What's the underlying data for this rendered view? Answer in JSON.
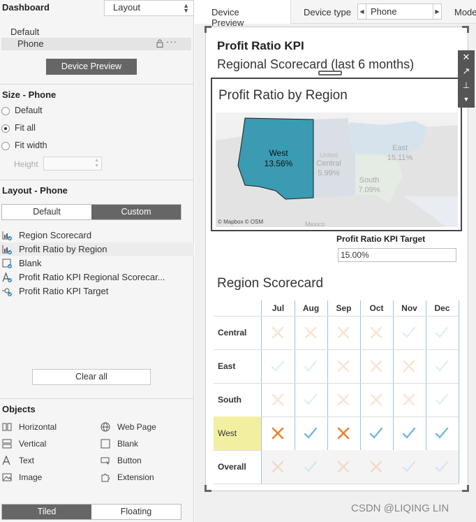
{
  "sidebar": {
    "title": "Dashboard",
    "layout_select": "Layout",
    "devices": [
      {
        "label": "Default"
      },
      {
        "label": "Phone"
      }
    ],
    "more_label": "···",
    "device_preview_btn": "Device Preview",
    "size_section": "Size - Phone",
    "size_options": [
      {
        "label": "Default",
        "selected": false
      },
      {
        "label": "Fit all",
        "selected": true
      },
      {
        "label": "Fit width",
        "selected": false
      }
    ],
    "height_label": "Height",
    "layout_section": "Layout - Phone",
    "layout_tabs": [
      {
        "label": "Default",
        "active": false
      },
      {
        "label": "Custom",
        "active": true
      }
    ],
    "items": [
      {
        "label": "Region Scorecard",
        "icon": "sheet-icon"
      },
      {
        "label": "Profit Ratio by Region",
        "icon": "sheet-icon"
      },
      {
        "label": "Blank",
        "icon": "blank-icon"
      },
      {
        "label": "Profit Ratio KPI Regional Scorecar...",
        "icon": "text-icon"
      },
      {
        "label": "Profit Ratio KPI Target",
        "icon": "parameter-icon"
      }
    ],
    "clear_all": "Clear all",
    "objects_section": "Objects",
    "objects": [
      {
        "label": "Horizontal",
        "icon": "horizontal-icon"
      },
      {
        "label": "Web Page",
        "icon": "globe-icon"
      },
      {
        "label": "Vertical",
        "icon": "vertical-icon"
      },
      {
        "label": "Blank",
        "icon": "blank-icon"
      },
      {
        "label": "Text",
        "icon": "text-icon"
      },
      {
        "label": "Button",
        "icon": "button-icon"
      },
      {
        "label": "Image",
        "icon": "image-icon"
      },
      {
        "label": "Extension",
        "icon": "extension-icon"
      }
    ],
    "placement_tabs": [
      {
        "label": "Tiled",
        "active": true
      },
      {
        "label": "Floating",
        "active": false
      }
    ]
  },
  "toolbar": {
    "device_preview_tab": "Device Preview",
    "device_type_label": "Device type",
    "device_type_value": "Phone",
    "model_label": "Mode"
  },
  "dashboard": {
    "title": "Profit Ratio KPI",
    "subtitle": "Regional Scorecard (last 6 months)",
    "map": {
      "title": "Profit Ratio by Region",
      "attribution": "© Mapbox © OSM",
      "regions": [
        {
          "name": "West",
          "value": "13.56%"
        },
        {
          "name": "Central",
          "value": "5.99%"
        },
        {
          "name": "East",
          "value": "15.11%"
        },
        {
          "name": "South",
          "value": "7.09%"
        }
      ],
      "map_labels": {
        "united": "United",
        "mexico": "Mexico"
      }
    },
    "kpi_target_label": "Profit Ratio KPI Target",
    "kpi_target_value": "15.00%",
    "scorecard": {
      "title": "Region Scorecard",
      "months": [
        "Jul",
        "Aug",
        "Sep",
        "Oct",
        "Nov",
        "Dec"
      ],
      "rows": [
        {
          "region": "Central",
          "marks": [
            "x",
            "x",
            "x",
            "x",
            "check",
            "check"
          ]
        },
        {
          "region": "East",
          "marks": [
            "check",
            "check",
            "x",
            "x",
            "x",
            "check"
          ]
        },
        {
          "region": "South",
          "marks": [
            "x",
            "check",
            "x",
            "x",
            "x",
            "check"
          ]
        },
        {
          "region": "West",
          "marks": [
            "x",
            "check",
            "x",
            "check",
            "check",
            "check"
          ]
        },
        {
          "region": "Overall",
          "marks": [
            "x",
            "check",
            "x",
            "x",
            "check",
            "check"
          ]
        }
      ],
      "highlighted_region": "West"
    }
  },
  "colors": {
    "map_west": "#3a9bb3",
    "x_mark": "#e8822d",
    "check_mark": "#74b8de",
    "west_highlight": "#f2f0a0",
    "dark_button": "#666666"
  },
  "watermark": "CSDN @LIQING LIN"
}
